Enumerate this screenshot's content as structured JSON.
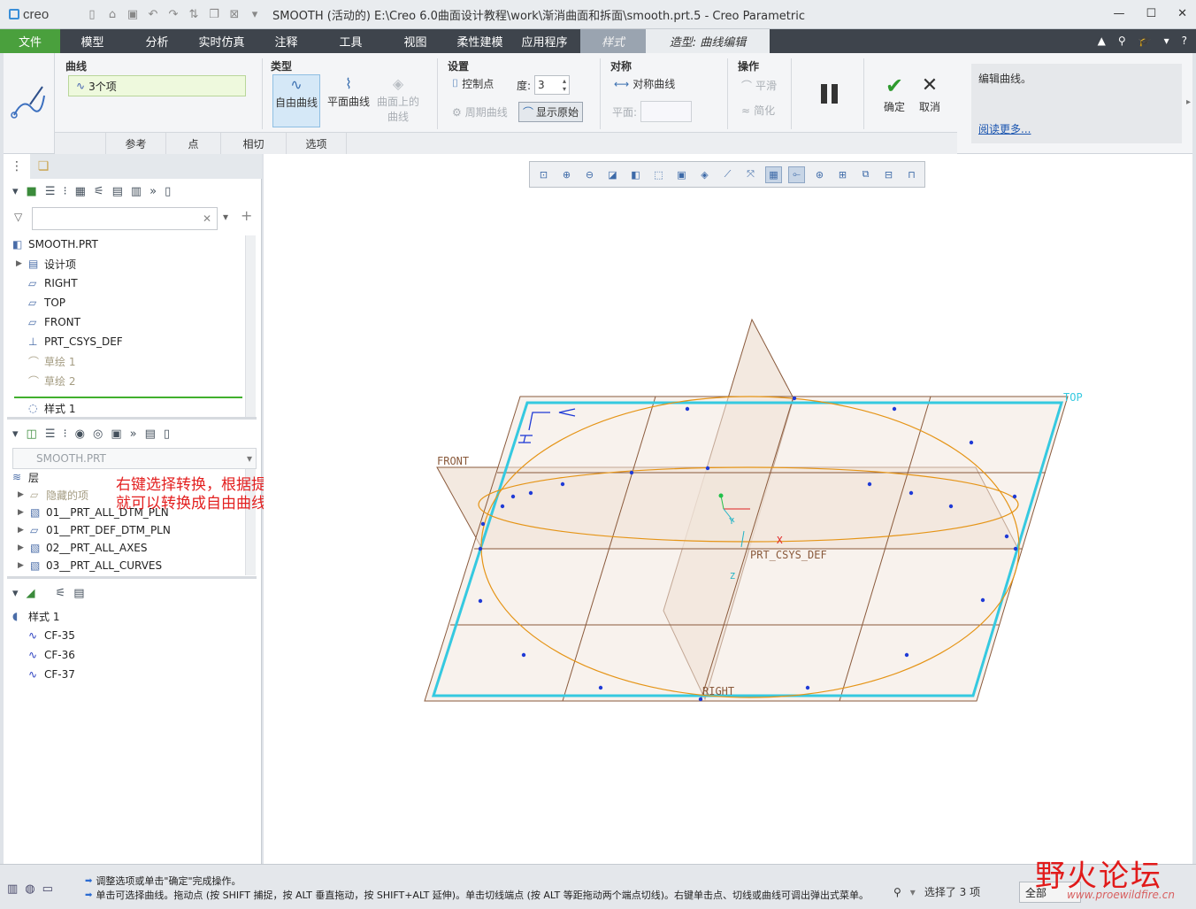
{
  "app": {
    "logo_text": "creo",
    "title": "SMOOTH (活动的) E:\\Creo 6.0曲面设计教程\\work\\渐消曲面和拆面\\smooth.prt.5 - Creo Parametric"
  },
  "menu": {
    "file": "文件",
    "items": [
      "模型",
      "分析",
      "实时仿真",
      "注释",
      "工具",
      "视图",
      "柔性建模",
      "应用程序"
    ],
    "style_tab": "样式",
    "active_tab": "造型: 曲线编辑"
  },
  "ribbon": {
    "curves_group": "曲线",
    "curves_value": "3个项",
    "type_group": "类型",
    "type_free": "自由曲线",
    "type_planar": "平面曲线",
    "type_cos_line1": "曲面上的",
    "type_cos_line2": "曲线",
    "settings_group": "设置",
    "control_points": "控制点",
    "degree_label": "度:",
    "degree_value": "3",
    "periodic_curve": "周期曲线",
    "show_original": "显示原始",
    "symmetry_group": "对称",
    "symmetric_curve": "对称曲线",
    "plane_label": "平面:",
    "operations_group": "操作",
    "smooth": "平滑",
    "simplify": "简化",
    "ok": "确定",
    "cancel": "取消",
    "subtabs": [
      "参考",
      "点",
      "相切",
      "选项"
    ],
    "help_text": "编辑曲线。",
    "help_link": "阅读更多..."
  },
  "model_tree": {
    "root": "SMOOTH.PRT",
    "items": [
      {
        "label": "设计项",
        "icon": "design-items-icon",
        "expandable": true,
        "dim": false
      },
      {
        "label": "RIGHT",
        "icon": "datum-plane-icon",
        "expandable": false,
        "dim": false
      },
      {
        "label": "TOP",
        "icon": "datum-plane-icon",
        "expandable": false,
        "dim": false
      },
      {
        "label": "FRONT",
        "icon": "datum-plane-icon",
        "expandable": false,
        "dim": false
      },
      {
        "label": "PRT_CSYS_DEF",
        "icon": "csys-icon",
        "expandable": false,
        "dim": false
      },
      {
        "label": "草绘 1",
        "icon": "sketch-icon",
        "expandable": false,
        "dim": true
      },
      {
        "label": "草绘 2",
        "icon": "sketch-icon",
        "expandable": false,
        "dim": true
      }
    ],
    "insert_item": "样式 1"
  },
  "layer_tree": {
    "selector_value": "SMOOTH.PRT",
    "header": "层",
    "items": [
      {
        "label": "隐藏的项",
        "dim": true
      },
      {
        "label": "01__PRT_ALL_DTM_PLN",
        "dim": false
      },
      {
        "label": "01__PRT_DEF_DTM_PLN",
        "dim": false
      },
      {
        "label": "02__PRT_ALL_AXES",
        "dim": false
      },
      {
        "label": "03__PRT_ALL_CURVES",
        "dim": false
      }
    ]
  },
  "style_tree": {
    "root": "样式 1",
    "items": [
      "CF-35",
      "CF-36",
      "CF-37"
    ]
  },
  "annotation": {
    "line1": "右键选择转换，根据提示",
    "line2": "就可以转换成自由曲线"
  },
  "viewport": {
    "labels": {
      "top": "TOP",
      "front": "FRONT",
      "right": "RIGHT",
      "csys": "PRT_CSYS_DEF",
      "x": "X",
      "y": "Y",
      "z": "Z"
    },
    "colors": {
      "plane_fill": "#f3e8df",
      "plane_edge": "#8a5a3c",
      "curve": "#e59416",
      "points": "#1f3ad6",
      "selection": "#35c9e0"
    }
  },
  "status": {
    "message1": "调整选项或单击\"确定\"完成操作。",
    "message2": "单击可选择曲线。拖动点 (按 SHIFT 捕捉，按 ALT 垂直拖动，按 SHIFT+ALT 延伸)。单击切线端点 (按 ALT 等距拖动两个端点切线)。右键单击点、切线或曲线可调出弹出式菜单。",
    "selected": "选择了 3 项",
    "filter": "全部"
  },
  "watermark": {
    "name": "野火论坛",
    "url": "www.proewildfire.cn"
  }
}
